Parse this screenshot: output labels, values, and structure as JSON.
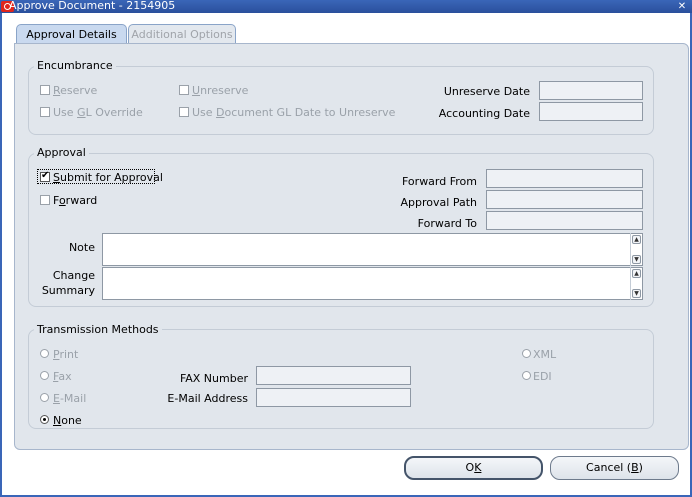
{
  "window": {
    "title": "Approve Document - 2154905"
  },
  "tabs": [
    {
      "label": "Approval Details"
    },
    {
      "label": "Additional Options"
    }
  ],
  "encumbrance": {
    "legend": "Encumbrance",
    "reserve_label": "Reserve",
    "reserve_mnemonic": "R",
    "reserve_rest": "eserve",
    "unreserve_mnemonic": "U",
    "unreserve_rest": "nreserve",
    "use_gl_pre": "Use ",
    "use_gl_mnemonic": "G",
    "use_gl_rest": "L Override",
    "use_doc_pre": "Use ",
    "use_doc_mnemonic": "D",
    "use_doc_rest": "ocument GL Date to Unreserve",
    "unreserve_date_label": "Unreserve Date",
    "unreserve_date_value": "",
    "accounting_date_label": "Accounting Date",
    "accounting_date_value": ""
  },
  "approval": {
    "legend": "Approval",
    "submit_mnemonic": "S",
    "submit_rest": "ubmit for Approval",
    "submit_checked": true,
    "forward_pre": "F",
    "forward_mnemonic": "o",
    "forward_rest": "rward",
    "forward_checked": false,
    "forward_from_label": "Forward From",
    "forward_from_value": "",
    "approval_path_label": "Approval Path",
    "approval_path_value": "",
    "forward_to_label": "Forward To",
    "forward_to_value": "",
    "note_label": "Note",
    "note_value": "",
    "change_summary_label_1": "Change",
    "change_summary_label_2": "Summary",
    "change_summary_value": ""
  },
  "transmission": {
    "legend": "Transmission Methods",
    "print_mnemonic": "P",
    "print_rest": "rint",
    "fax_mnemonic": "F",
    "fax_rest": "ax",
    "email_mnemonic": "E",
    "email_rest": "-Mail",
    "none_mnemonic": "N",
    "none_rest": "one",
    "selected": "None",
    "xml_label": "XML",
    "edi_label": "EDI",
    "fax_number_label": "FAX Number",
    "fax_number_value": "",
    "email_address_label": "E-Mail Address",
    "email_address_value": ""
  },
  "buttons": {
    "ok_pre": "O",
    "ok_mnemonic": "K",
    "cancel_pre": "Cancel (",
    "cancel_mnemonic": "B",
    "cancel_post": ")"
  },
  "colors": {
    "titlebar": "#2a4f9c",
    "panel": "#e1e6ec",
    "active_tab": "#c9d9ef",
    "field": "#eef1f5",
    "oracle_red": "#e0261d"
  }
}
